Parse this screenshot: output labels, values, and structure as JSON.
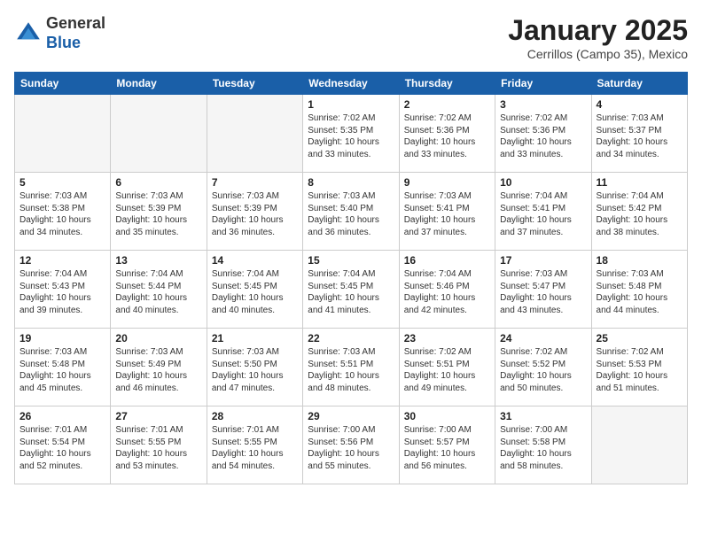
{
  "header": {
    "logo_general": "General",
    "logo_blue": "Blue",
    "title": "January 2025",
    "subtitle": "Cerrillos (Campo 35), Mexico"
  },
  "weekdays": [
    "Sunday",
    "Monday",
    "Tuesday",
    "Wednesday",
    "Thursday",
    "Friday",
    "Saturday"
  ],
  "weeks": [
    [
      {
        "day": "",
        "empty": true
      },
      {
        "day": "",
        "empty": true
      },
      {
        "day": "",
        "empty": true
      },
      {
        "day": "1",
        "sunrise": "Sunrise: 7:02 AM",
        "sunset": "Sunset: 5:35 PM",
        "daylight": "Daylight: 10 hours and 33 minutes."
      },
      {
        "day": "2",
        "sunrise": "Sunrise: 7:02 AM",
        "sunset": "Sunset: 5:36 PM",
        "daylight": "Daylight: 10 hours and 33 minutes."
      },
      {
        "day": "3",
        "sunrise": "Sunrise: 7:02 AM",
        "sunset": "Sunset: 5:36 PM",
        "daylight": "Daylight: 10 hours and 33 minutes."
      },
      {
        "day": "4",
        "sunrise": "Sunrise: 7:03 AM",
        "sunset": "Sunset: 5:37 PM",
        "daylight": "Daylight: 10 hours and 34 minutes."
      }
    ],
    [
      {
        "day": "5",
        "sunrise": "Sunrise: 7:03 AM",
        "sunset": "Sunset: 5:38 PM",
        "daylight": "Daylight: 10 hours and 34 minutes."
      },
      {
        "day": "6",
        "sunrise": "Sunrise: 7:03 AM",
        "sunset": "Sunset: 5:39 PM",
        "daylight": "Daylight: 10 hours and 35 minutes."
      },
      {
        "day": "7",
        "sunrise": "Sunrise: 7:03 AM",
        "sunset": "Sunset: 5:39 PM",
        "daylight": "Daylight: 10 hours and 36 minutes."
      },
      {
        "day": "8",
        "sunrise": "Sunrise: 7:03 AM",
        "sunset": "Sunset: 5:40 PM",
        "daylight": "Daylight: 10 hours and 36 minutes."
      },
      {
        "day": "9",
        "sunrise": "Sunrise: 7:03 AM",
        "sunset": "Sunset: 5:41 PM",
        "daylight": "Daylight: 10 hours and 37 minutes."
      },
      {
        "day": "10",
        "sunrise": "Sunrise: 7:04 AM",
        "sunset": "Sunset: 5:41 PM",
        "daylight": "Daylight: 10 hours and 37 minutes."
      },
      {
        "day": "11",
        "sunrise": "Sunrise: 7:04 AM",
        "sunset": "Sunset: 5:42 PM",
        "daylight": "Daylight: 10 hours and 38 minutes."
      }
    ],
    [
      {
        "day": "12",
        "sunrise": "Sunrise: 7:04 AM",
        "sunset": "Sunset: 5:43 PM",
        "daylight": "Daylight: 10 hours and 39 minutes."
      },
      {
        "day": "13",
        "sunrise": "Sunrise: 7:04 AM",
        "sunset": "Sunset: 5:44 PM",
        "daylight": "Daylight: 10 hours and 40 minutes."
      },
      {
        "day": "14",
        "sunrise": "Sunrise: 7:04 AM",
        "sunset": "Sunset: 5:45 PM",
        "daylight": "Daylight: 10 hours and 40 minutes."
      },
      {
        "day": "15",
        "sunrise": "Sunrise: 7:04 AM",
        "sunset": "Sunset: 5:45 PM",
        "daylight": "Daylight: 10 hours and 41 minutes."
      },
      {
        "day": "16",
        "sunrise": "Sunrise: 7:04 AM",
        "sunset": "Sunset: 5:46 PM",
        "daylight": "Daylight: 10 hours and 42 minutes."
      },
      {
        "day": "17",
        "sunrise": "Sunrise: 7:03 AM",
        "sunset": "Sunset: 5:47 PM",
        "daylight": "Daylight: 10 hours and 43 minutes."
      },
      {
        "day": "18",
        "sunrise": "Sunrise: 7:03 AM",
        "sunset": "Sunset: 5:48 PM",
        "daylight": "Daylight: 10 hours and 44 minutes."
      }
    ],
    [
      {
        "day": "19",
        "sunrise": "Sunrise: 7:03 AM",
        "sunset": "Sunset: 5:48 PM",
        "daylight": "Daylight: 10 hours and 45 minutes."
      },
      {
        "day": "20",
        "sunrise": "Sunrise: 7:03 AM",
        "sunset": "Sunset: 5:49 PM",
        "daylight": "Daylight: 10 hours and 46 minutes."
      },
      {
        "day": "21",
        "sunrise": "Sunrise: 7:03 AM",
        "sunset": "Sunset: 5:50 PM",
        "daylight": "Daylight: 10 hours and 47 minutes."
      },
      {
        "day": "22",
        "sunrise": "Sunrise: 7:03 AM",
        "sunset": "Sunset: 5:51 PM",
        "daylight": "Daylight: 10 hours and 48 minutes."
      },
      {
        "day": "23",
        "sunrise": "Sunrise: 7:02 AM",
        "sunset": "Sunset: 5:51 PM",
        "daylight": "Daylight: 10 hours and 49 minutes."
      },
      {
        "day": "24",
        "sunrise": "Sunrise: 7:02 AM",
        "sunset": "Sunset: 5:52 PM",
        "daylight": "Daylight: 10 hours and 50 minutes."
      },
      {
        "day": "25",
        "sunrise": "Sunrise: 7:02 AM",
        "sunset": "Sunset: 5:53 PM",
        "daylight": "Daylight: 10 hours and 51 minutes."
      }
    ],
    [
      {
        "day": "26",
        "sunrise": "Sunrise: 7:01 AM",
        "sunset": "Sunset: 5:54 PM",
        "daylight": "Daylight: 10 hours and 52 minutes."
      },
      {
        "day": "27",
        "sunrise": "Sunrise: 7:01 AM",
        "sunset": "Sunset: 5:55 PM",
        "daylight": "Daylight: 10 hours and 53 minutes."
      },
      {
        "day": "28",
        "sunrise": "Sunrise: 7:01 AM",
        "sunset": "Sunset: 5:55 PM",
        "daylight": "Daylight: 10 hours and 54 minutes."
      },
      {
        "day": "29",
        "sunrise": "Sunrise: 7:00 AM",
        "sunset": "Sunset: 5:56 PM",
        "daylight": "Daylight: 10 hours and 55 minutes."
      },
      {
        "day": "30",
        "sunrise": "Sunrise: 7:00 AM",
        "sunset": "Sunset: 5:57 PM",
        "daylight": "Daylight: 10 hours and 56 minutes."
      },
      {
        "day": "31",
        "sunrise": "Sunrise: 7:00 AM",
        "sunset": "Sunset: 5:58 PM",
        "daylight": "Daylight: 10 hours and 58 minutes."
      },
      {
        "day": "",
        "empty": true
      }
    ]
  ]
}
